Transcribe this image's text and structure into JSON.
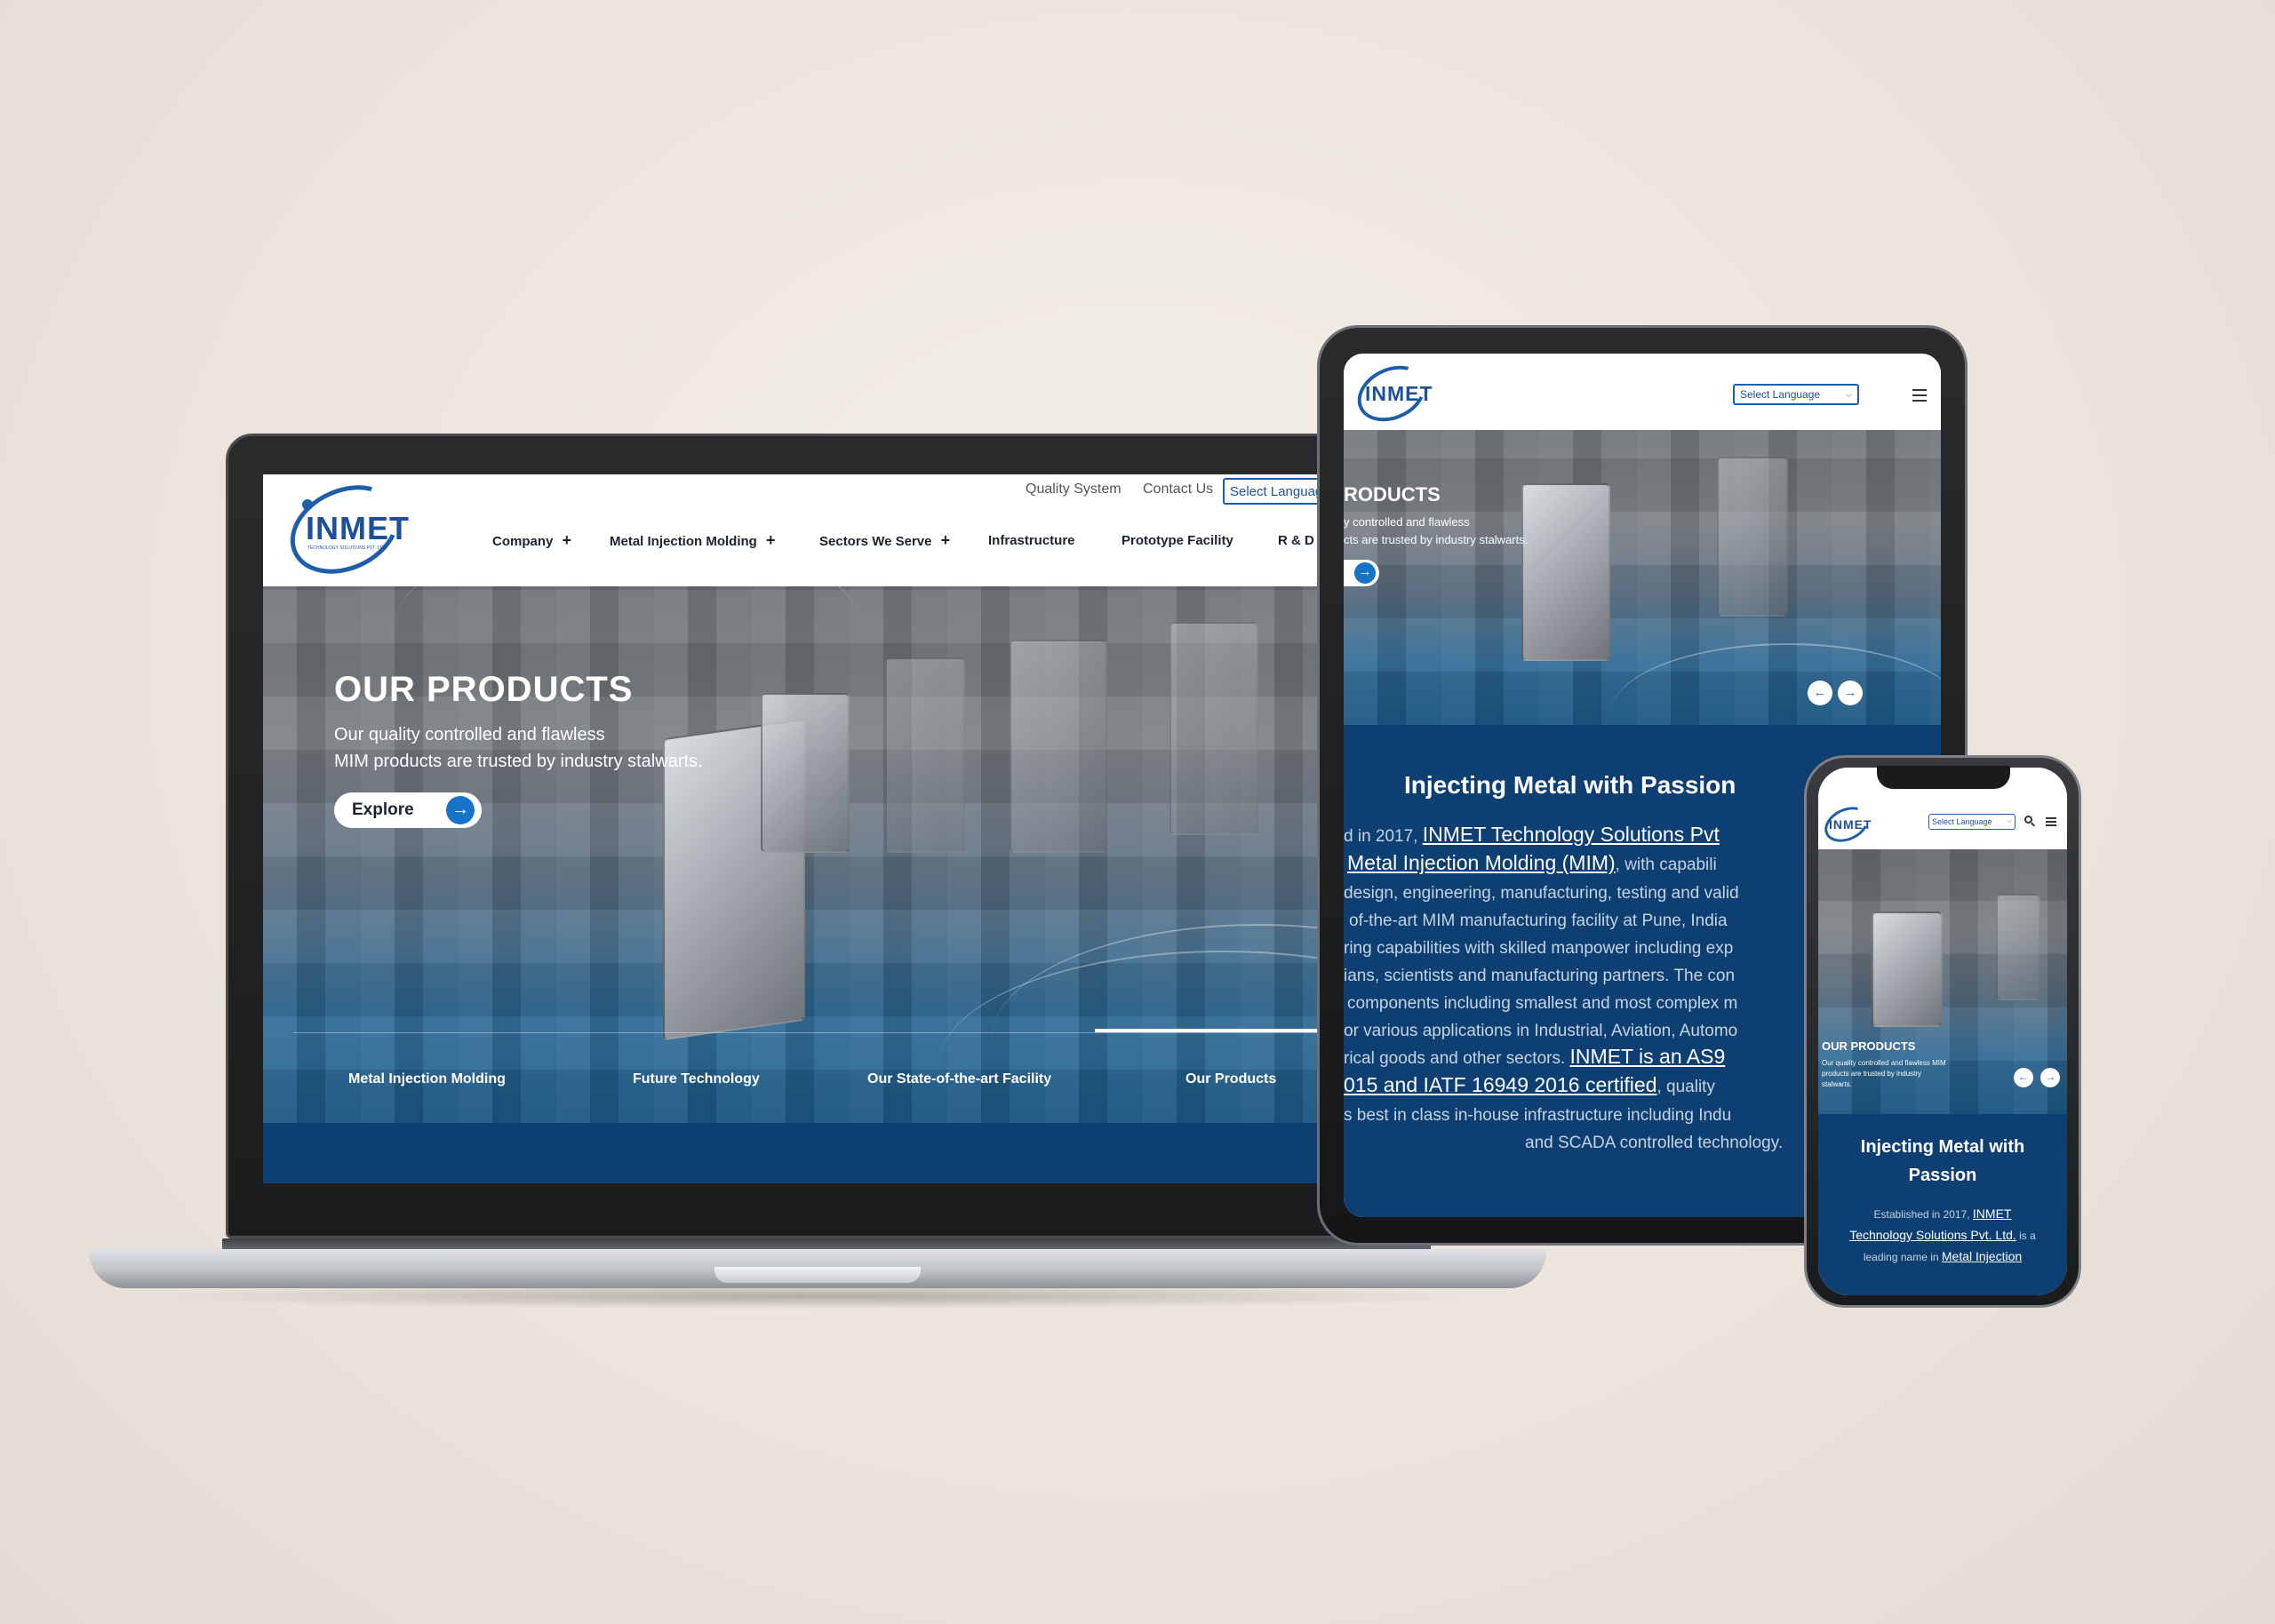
{
  "brand": {
    "logo_text": "INMET",
    "logo_tagline": "TECHNOLOGY SOLUTIONS PVT. LTD.",
    "primary_color": "#1d4f9a",
    "dark_blue": "#0d3f73"
  },
  "desktop": {
    "top_links": [
      "Quality System",
      "Contact Us"
    ],
    "language_select": "Select Language",
    "nav": [
      {
        "label": "Company",
        "suffix": "+"
      },
      {
        "label": "Metal Injection Molding",
        "suffix": "+"
      },
      {
        "label": "Sectors We Serve",
        "suffix": "+"
      },
      {
        "label": "Infrastructure",
        "suffix": ""
      },
      {
        "label": "Prototype Facility",
        "suffix": ""
      },
      {
        "label": "R & D",
        "suffix": ""
      }
    ],
    "search_icon": "search-icon",
    "hero": {
      "title": "OUR PRODUCTS",
      "subtitle_line1": "Our quality controlled and flawless",
      "subtitle_line2": "MIM products are trusted by industry stalwarts.",
      "cta_label": "Explore"
    },
    "tabs": [
      "Metal Injection Molding",
      "Future Technology",
      "Our State-of-the-art Facility",
      "Our Products"
    ],
    "active_tab": "Our Products"
  },
  "tablet": {
    "language_select": "Select Language",
    "hero_title": "RODUCTS",
    "hero_line1": "y controlled and flawless",
    "hero_line2": "cts are trusted by industry stalwarts.",
    "section_title": "Injecting Metal with Passion",
    "para": {
      "l1_pre": "d in 2017, ",
      "l1_link": "INMET Technology Solutions Pvt",
      "l2_link": "Metal Injection Molding (MIM)",
      "l2_post": ", with capabili",
      "l3": "design, engineering, manufacturing, testing and valid",
      "l4": "of-the-art MIM manufacturing facility at Pune, India",
      "l5": "ring capabilities with skilled manpower including exp",
      "l6": "ians, scientists and manufacturing partners. The con",
      "l7": "components including smallest and most complex m",
      "l8": "or various applications in Industrial, Aviation, Automo",
      "l9_pre": "rical goods and other sectors. ",
      "l9_link": "INMET is an AS9",
      "l10_link": "015 and IATF 16949 2016 certified",
      "l10_post": ", quality",
      "l11": "s best in class in-house infrastructure including Indu",
      "l12": "and SCADA controlled technology."
    }
  },
  "phone": {
    "language_select": "Select Language",
    "hero_title": "OUR PRODUCTS",
    "hero_line1": "Our quality controlled and flawless MIM",
    "hero_line2": "products are trusted by industry",
    "hero_line3": "stalwarts.",
    "section_title_l1": "Injecting Metal with",
    "section_title_l2": "Passion",
    "para_l1_pre": "Established in 2017, ",
    "para_l1_link": "INMET",
    "para_l2_link": "Technology Solutions Pvt. Ltd.",
    "para_l2_post": " is a",
    "para_l3_pre": "leading name in ",
    "para_l3_link": "Metal Injection"
  }
}
